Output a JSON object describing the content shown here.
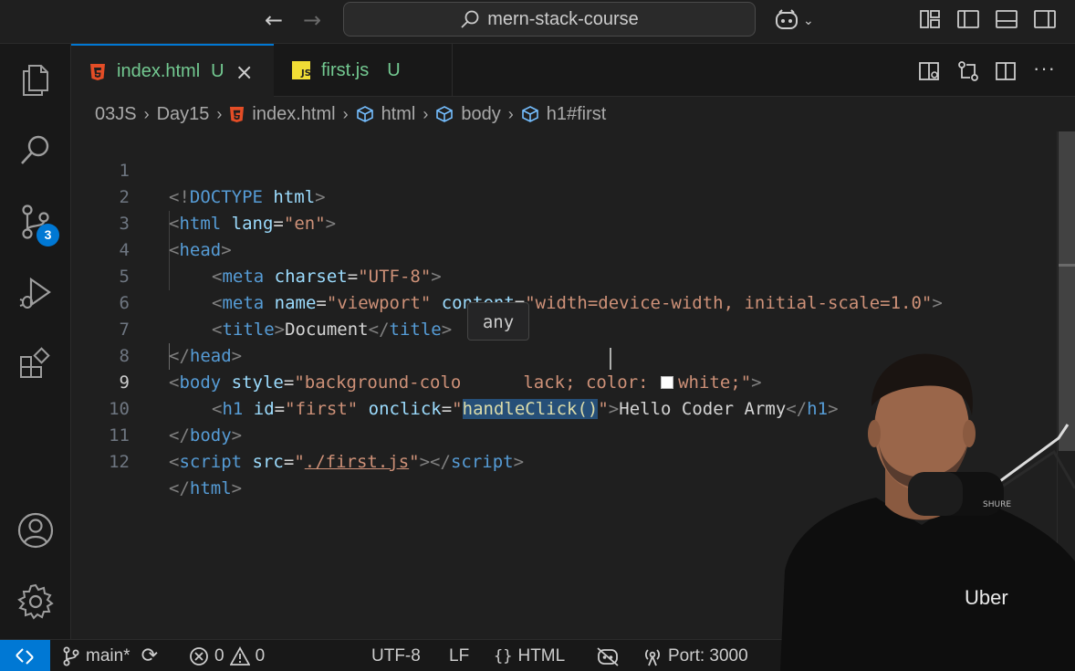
{
  "titlebar": {
    "search_label": "mern-stack-course"
  },
  "tabs": [
    {
      "label": "index.html",
      "status": "U",
      "icon": "html5-icon"
    },
    {
      "label": "first.js",
      "status": "U",
      "icon": "js-icon"
    }
  ],
  "breadcrumbs": {
    "items": [
      "03JS",
      "Day15",
      "index.html",
      "html",
      "body",
      "h1#first"
    ]
  },
  "activity_bar": {
    "source_control_badge": "3"
  },
  "editor": {
    "current_line": 9,
    "line_numbers": [
      "1",
      "2",
      "3",
      "4",
      "5",
      "6",
      "7",
      "8",
      "9",
      "10",
      "11",
      "12"
    ],
    "hover_text": "any",
    "lines": {
      "l1": {
        "a": "<!",
        "b": "DOCTYPE",
        "c": " html",
        "d": ">"
      },
      "l2": {
        "a": "<",
        "b": "html",
        "c": " lang",
        "d": "=",
        "e": "\"en\"",
        "f": ">"
      },
      "l3": {
        "a": "<",
        "b": "head",
        "c": ">"
      },
      "l4": {
        "a": "<",
        "b": "meta",
        "c": " charset",
        "d": "=",
        "e": "\"UTF-8\"",
        "f": ">"
      },
      "l5": {
        "a": "<",
        "b": "meta",
        "c": " name",
        "d": "=",
        "e": "\"viewport\"",
        "f": " content",
        "g": "=",
        "h": "\"width=device-width, initial-scale=1.0\"",
        "i": ">"
      },
      "l6": {
        "a": "<",
        "b": "title",
        "c": ">",
        "d": "Document",
        "e": "</",
        "f": "title",
        "g": ">"
      },
      "l7": {
        "a": "</",
        "b": "head",
        "c": ">"
      },
      "l8": {
        "a": "<",
        "b": "body",
        "c": " style",
        "d": "=",
        "e": "\"background-colo",
        "f": "lack; color: ",
        "g": "white;\"",
        "h": ">"
      },
      "l9": {
        "a": "<",
        "b": "h1",
        "c": " id",
        "d": "=",
        "e": "\"first\"",
        "f": " onclick",
        "g": "=",
        "h": "\"",
        "i": "handleClick()",
        "j": "\"",
        "k": ">",
        "l": "Hello Coder Army",
        "m": "</",
        "n": "h1",
        "o": ">"
      },
      "l10": {
        "a": "</",
        "b": "body",
        "c": ">"
      },
      "l11": {
        "a": "<",
        "b": "script",
        "c": " src",
        "d": "=",
        "e": "\"",
        "f": "./first.js",
        "g": "\"",
        "h": "></",
        "i": "script",
        "j": ">"
      },
      "l12": {
        "a": "</",
        "b": "html",
        "c": ">"
      }
    }
  },
  "statusbar": {
    "branch": "main*",
    "errors": "0",
    "warnings": "0",
    "encoding": "UTF-8",
    "eol": "LF",
    "language": "HTML",
    "port": "Port: 3000"
  },
  "presenter": {
    "shirt_logo": "Uber"
  },
  "colors": {
    "accent": "#0078d4",
    "tag": "#569cd6",
    "attribute": "#9cdcfe",
    "string": "#ce9178",
    "untracked": "#73c991",
    "selection": "#264f78"
  }
}
